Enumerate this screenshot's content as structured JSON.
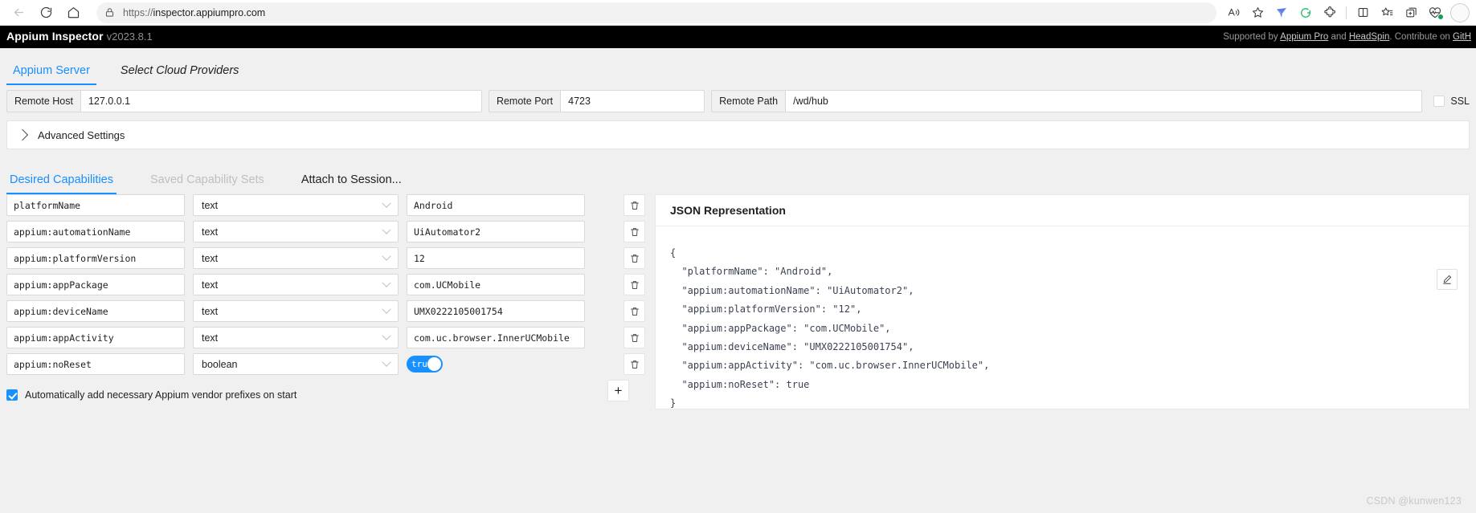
{
  "browser": {
    "url_scheme": "https://",
    "url_rest": "inspector.appiumpro.com",
    "back_icon": "back-arrow-icon",
    "reload_icon": "reload-icon",
    "home_icon": "home-icon",
    "lock_icon": "lock-icon",
    "read_aloud_icon": "read-aloud-icon",
    "favorite_icon": "star-icon",
    "extension_icons": [
      "blue-bird-icon",
      "grammarly-icon",
      "puzzle-extension-icon"
    ],
    "split_screen_icon": "split-screen-icon",
    "collections_icon": "collections-star-icon",
    "add_tab_icon": "add-to-collection-icon",
    "wellness_icon": "browser-essentials-icon",
    "profile_icon": "profile-avatar-icon"
  },
  "app": {
    "title": "Appium Inspector",
    "version": "v2023.8.1",
    "credits_prefix": "Supported by ",
    "credits_link1": "Appium Pro",
    "credits_mid": " and ",
    "credits_link2": "HeadSpin",
    "credits_suffix": ". Contribute on ",
    "credits_link3": "GitH"
  },
  "top_tabs": [
    {
      "label": "Appium Server",
      "active": true
    },
    {
      "label": "Select Cloud Providers",
      "active": false
    }
  ],
  "server": {
    "host_label": "Remote Host",
    "host_value": "127.0.0.1",
    "port_label": "Remote Port",
    "port_value": "4723",
    "path_label": "Remote Path",
    "path_value": "/wd/hub",
    "ssl_label": "SSL",
    "ssl_checked": false
  },
  "advanced": {
    "label": "Advanced Settings",
    "expanded": false,
    "chevron_icon": "chevron-right-icon"
  },
  "cap_tabs": [
    {
      "label": "Desired Capabilities",
      "active": true,
      "disabled": false
    },
    {
      "label": "Saved Capability Sets",
      "active": false,
      "disabled": true
    },
    {
      "label": "Attach to Session...",
      "active": false,
      "disabled": false
    }
  ],
  "capabilities": [
    {
      "name": "platformName",
      "type": "text",
      "value": "Android",
      "is_bool": false
    },
    {
      "name": "appium:automationName",
      "type": "text",
      "value": "UiAutomator2",
      "is_bool": false
    },
    {
      "name": "appium:platformVersion",
      "type": "text",
      "value": "12",
      "is_bool": false
    },
    {
      "name": "appium:appPackage",
      "type": "text",
      "value": "com.UCMobile",
      "is_bool": false
    },
    {
      "name": "appium:deviceName",
      "type": "text",
      "value": "UMX0222105001754",
      "is_bool": false
    },
    {
      "name": "appium:appActivity",
      "type": "text",
      "value": "com.uc.browser.InnerUCMobile",
      "is_bool": false
    },
    {
      "name": "appium:noReset",
      "type": "boolean",
      "value": "true",
      "is_bool": true
    }
  ],
  "cap_actions": {
    "delete_icon": "trash-icon",
    "add_label": "+",
    "add_icon": "plus-icon"
  },
  "vendor_prefix": {
    "label": "Automatically add necessary Appium vendor prefixes on start",
    "checked": true
  },
  "json_panel": {
    "title": "JSON Representation",
    "edit_icon": "pencil-edit-icon",
    "content": "{\n  \"platformName\": \"Android\",\n  \"appium:automationName\": \"UiAutomator2\",\n  \"appium:platformVersion\": \"12\",\n  \"appium:appPackage\": \"com.UCMobile\",\n  \"appium:deviceName\": \"UMX0222105001754\",\n  \"appium:appActivity\": \"com.uc.browser.InnerUCMobile\",\n  \"appium:noReset\": true\n}"
  },
  "watermark": "CSDN @kunwen123",
  "colors": {
    "accent": "#1890ff",
    "header_bg": "#000000",
    "page_bg": "#f0f0f0"
  }
}
